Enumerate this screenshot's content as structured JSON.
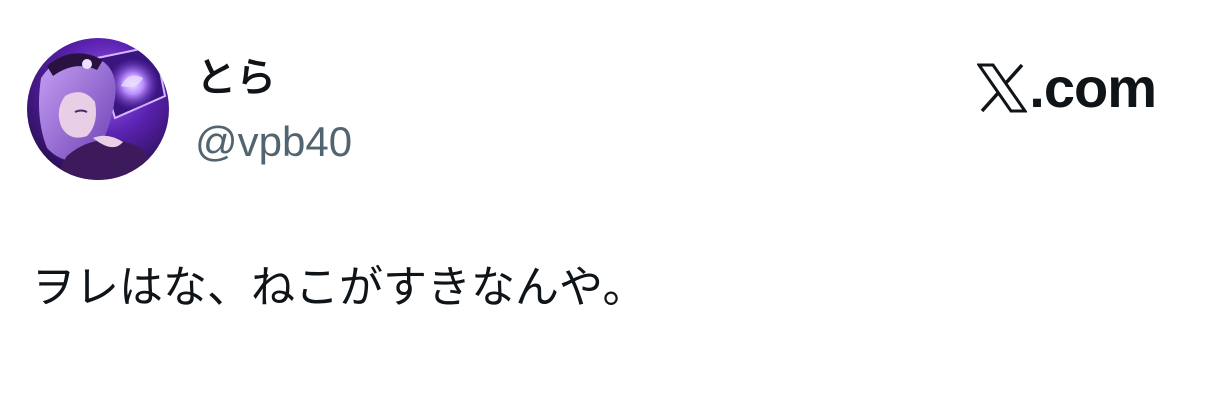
{
  "post": {
    "author": {
      "display_name": "とら",
      "handle": "@vpb40",
      "avatar_icon": "anime-character-avatar"
    },
    "brand": {
      "logo_icon": "x-logo-icon",
      "suffix": ".com"
    },
    "text": "ヲレはな、ねこがすきなんや。"
  },
  "colors": {
    "background": "#ffffff",
    "text_primary": "#0f1419",
    "text_secondary": "#536471",
    "avatar_purple": "#6a2fc7"
  }
}
